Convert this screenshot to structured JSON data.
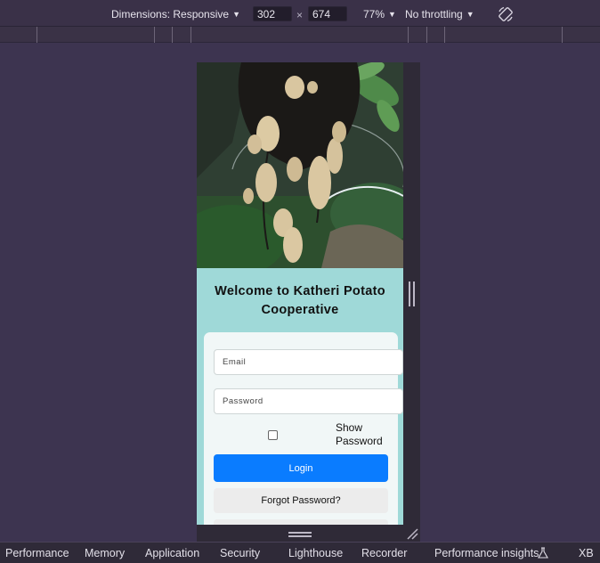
{
  "toolbar": {
    "dimensions_label": "Dimensions: Responsive",
    "width_value": "302",
    "times": "×",
    "height_value": "674",
    "zoom": "77%",
    "throttling": "No throttling"
  },
  "page": {
    "heading": "Welcome to Katheri Potato Cooperative",
    "email_placeholder": "Email",
    "password_placeholder": "Password",
    "show_password_label": "Show Password",
    "show_password_checked": false,
    "login_label": "Login",
    "forgot_label": "Forgot Password?"
  },
  "devtools_tabs": [
    "Performance",
    "Memory",
    "Application",
    "Security",
    "Lighthouse",
    "Recorder",
    "Performance insights",
    "XB"
  ],
  "colors": {
    "accent": "#0a7cff",
    "page_background": "#9fd9d8",
    "devtools_background": "#3d3450"
  }
}
